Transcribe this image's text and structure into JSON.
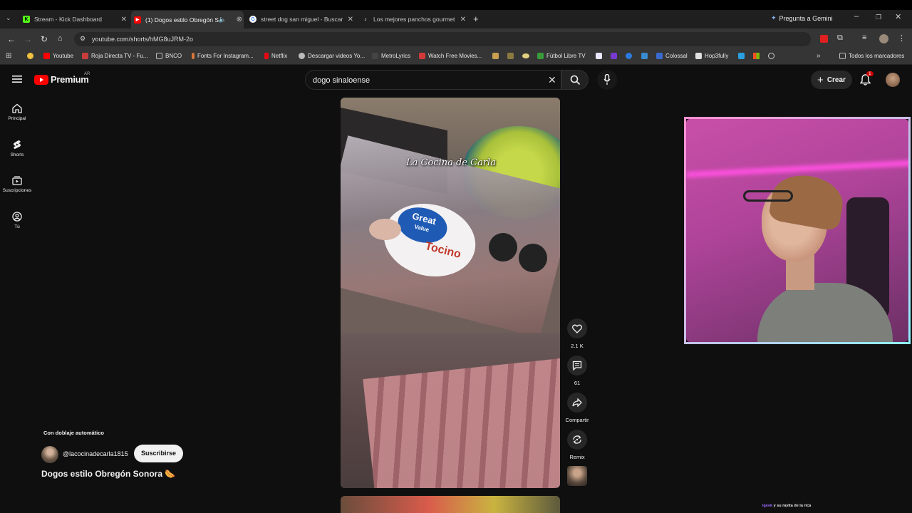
{
  "browser": {
    "tabs": [
      {
        "title": "Stream - Kick Dashboard",
        "icon": "kick-icon",
        "color": "#53fc18"
      },
      {
        "title": "(1) Dogos estilo Obregón S",
        "icon": "youtube-icon",
        "color": "#ff0000"
      },
      {
        "title": "street dog san miguel - Buscar",
        "icon": "google-icon",
        "color": "#4285f4"
      },
      {
        "title": "Los mejores panchos gourmet",
        "icon": "tiktok-icon",
        "color": "#ffffff"
      }
    ],
    "gemini_label": "Pregunta a Gemini",
    "url": "youtube.com/shorts/hMG8uJRM-2o",
    "bookmarks": [
      {
        "label": "Youtube",
        "color": "#ff0000"
      },
      {
        "label": "Roja Directa TV - Fu...",
        "color": "#c83c3c"
      },
      {
        "label": "BNCO",
        "color": "#9a9a9a"
      },
      {
        "label": "Fonts For Instagram...",
        "color": "#d9773a"
      },
      {
        "label": "Netflix",
        "color": "#e50914"
      },
      {
        "label": "Descargar videos Yo...",
        "color": "#bbbbbb"
      },
      {
        "label": "MetroLyrics",
        "color": "#444444"
      },
      {
        "label": "Watch Free Movies...",
        "color": "#d23a3a"
      },
      {
        "label": "Fútbol Libre TV",
        "color": "#3a9a3a"
      },
      {
        "label": "Colossal",
        "color": "#3a6ad0"
      },
      {
        "label": "Hop3fully",
        "color": "#e0e0e0"
      }
    ],
    "all_bookmarks": "Todos los marcadores"
  },
  "youtube": {
    "logo_text": "Premium",
    "country": "AR",
    "nav": [
      {
        "label": "Principal",
        "icon": "home-icon"
      },
      {
        "label": "Shorts",
        "icon": "shorts-icon"
      },
      {
        "label": "Suscripciones",
        "icon": "subscriptions-icon"
      },
      {
        "label": "Tú",
        "icon": "you-icon"
      }
    ],
    "search_value": "dogo sinaloense",
    "create_label": "Crear",
    "notif_count": "1",
    "video_watermark": "La Cocina de Carla",
    "dub_label": "Con doblaje automático",
    "channel": "@lacocinadecarla1815",
    "subscribe_label": "Suscribirse",
    "video_title": "Dogos estilo Obregón Sonora 🌭",
    "actions": {
      "likes": "2.1 K",
      "comments": "61",
      "share": "Compartir",
      "remix": "Remix"
    }
  },
  "overlay": {
    "ticker_user": "lgeek",
    "ticker_text": "y su rayita de la rica"
  }
}
